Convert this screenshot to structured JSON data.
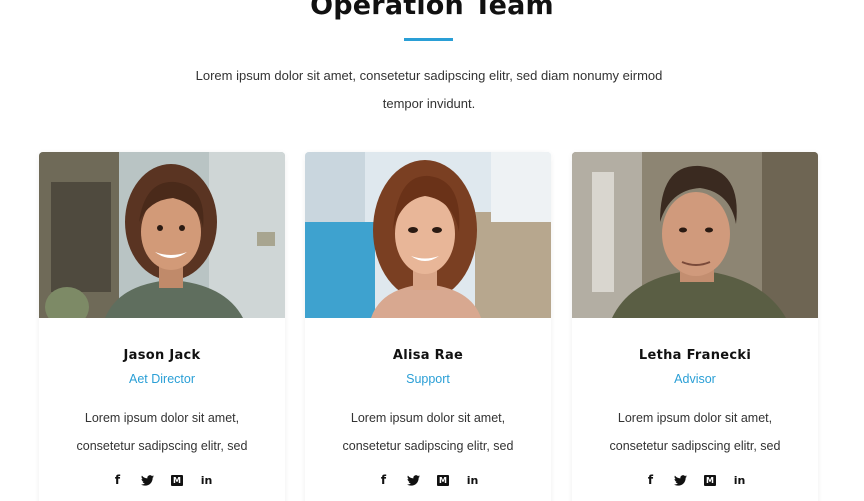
{
  "section": {
    "title": "Operation Team",
    "description": "Lorem ipsum dolor sit amet, consetetur sadipscing elitr, sed diam nonumy eirmod tempor invidunt."
  },
  "colors": {
    "accent": "#2a9fd6",
    "heading": "#111111",
    "text": "#333333"
  },
  "members": [
    {
      "name": "Jason Jack",
      "role": "Aet Director",
      "bio": "Lorem ipsum dolor sit amet, consetetur sadipscing elitr, sed",
      "socials": [
        {
          "icon": "facebook-icon",
          "glyph": "f"
        },
        {
          "icon": "twitter-icon",
          "glyph": "🐦"
        },
        {
          "icon": "medium-icon",
          "glyph": "M"
        },
        {
          "icon": "linkedin-icon",
          "glyph": "in"
        }
      ]
    },
    {
      "name": "Alisa Rae",
      "role": "Support",
      "bio": "Lorem ipsum dolor sit amet, consetetur sadipscing elitr, sed",
      "socials": [
        {
          "icon": "facebook-icon",
          "glyph": "f"
        },
        {
          "icon": "twitter-icon",
          "glyph": "🐦"
        },
        {
          "icon": "medium-icon",
          "glyph": "M"
        },
        {
          "icon": "linkedin-icon",
          "glyph": "in"
        }
      ]
    },
    {
      "name": "Letha Franecki",
      "role": "Advisor",
      "bio": "Lorem ipsum dolor sit amet, consetetur sadipscing elitr, sed",
      "socials": [
        {
          "icon": "facebook-icon",
          "glyph": "f"
        },
        {
          "icon": "twitter-icon",
          "glyph": "🐦"
        },
        {
          "icon": "medium-icon",
          "glyph": "M"
        },
        {
          "icon": "linkedin-icon",
          "glyph": "in"
        }
      ]
    }
  ]
}
